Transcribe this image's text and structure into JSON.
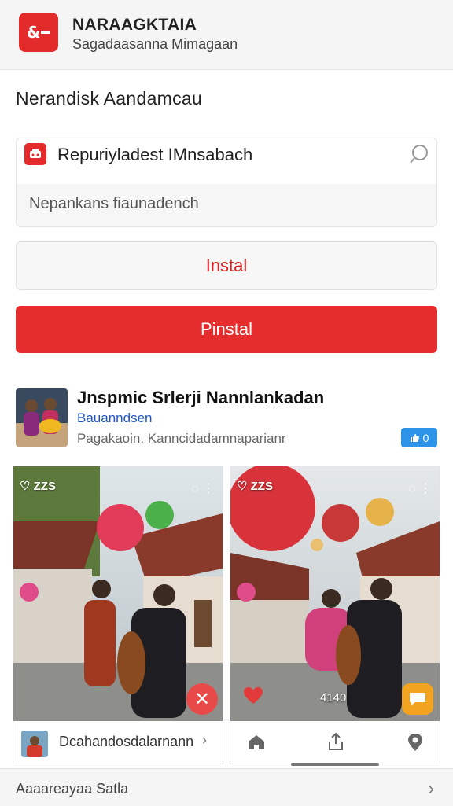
{
  "header": {
    "app_name": "NARAAGKTAIA",
    "app_subtitle": "Sagadaasanna Mimagaan"
  },
  "section_title": "Nerandisk  Aandamcau",
  "search_card": {
    "title": "Repuriyladest IMnsabach",
    "input_value": "Nepankans fiaunadench"
  },
  "buttons": {
    "secondary_label": "Instal",
    "primary_label": "Pinstal"
  },
  "profile": {
    "name": "Jnspmic Srlerji Nannlankadan",
    "link": "Bauanndsen",
    "description": "Pagakaoin. Kanncidadamnaparianr",
    "badge_count": "0"
  },
  "cards": [
    {
      "top_left_label": "ZZS",
      "footer_label": "Dcahandosdalarnann"
    },
    {
      "top_left_label": "ZZS",
      "count_label": "4140"
    }
  ],
  "bottom_bar": {
    "label": "Aaaareayaa Satla"
  },
  "colors": {
    "accent_red": "#e62d2d",
    "link_blue": "#1f56c4",
    "badge_blue": "#2d93e8",
    "orange": "#f2a320"
  }
}
